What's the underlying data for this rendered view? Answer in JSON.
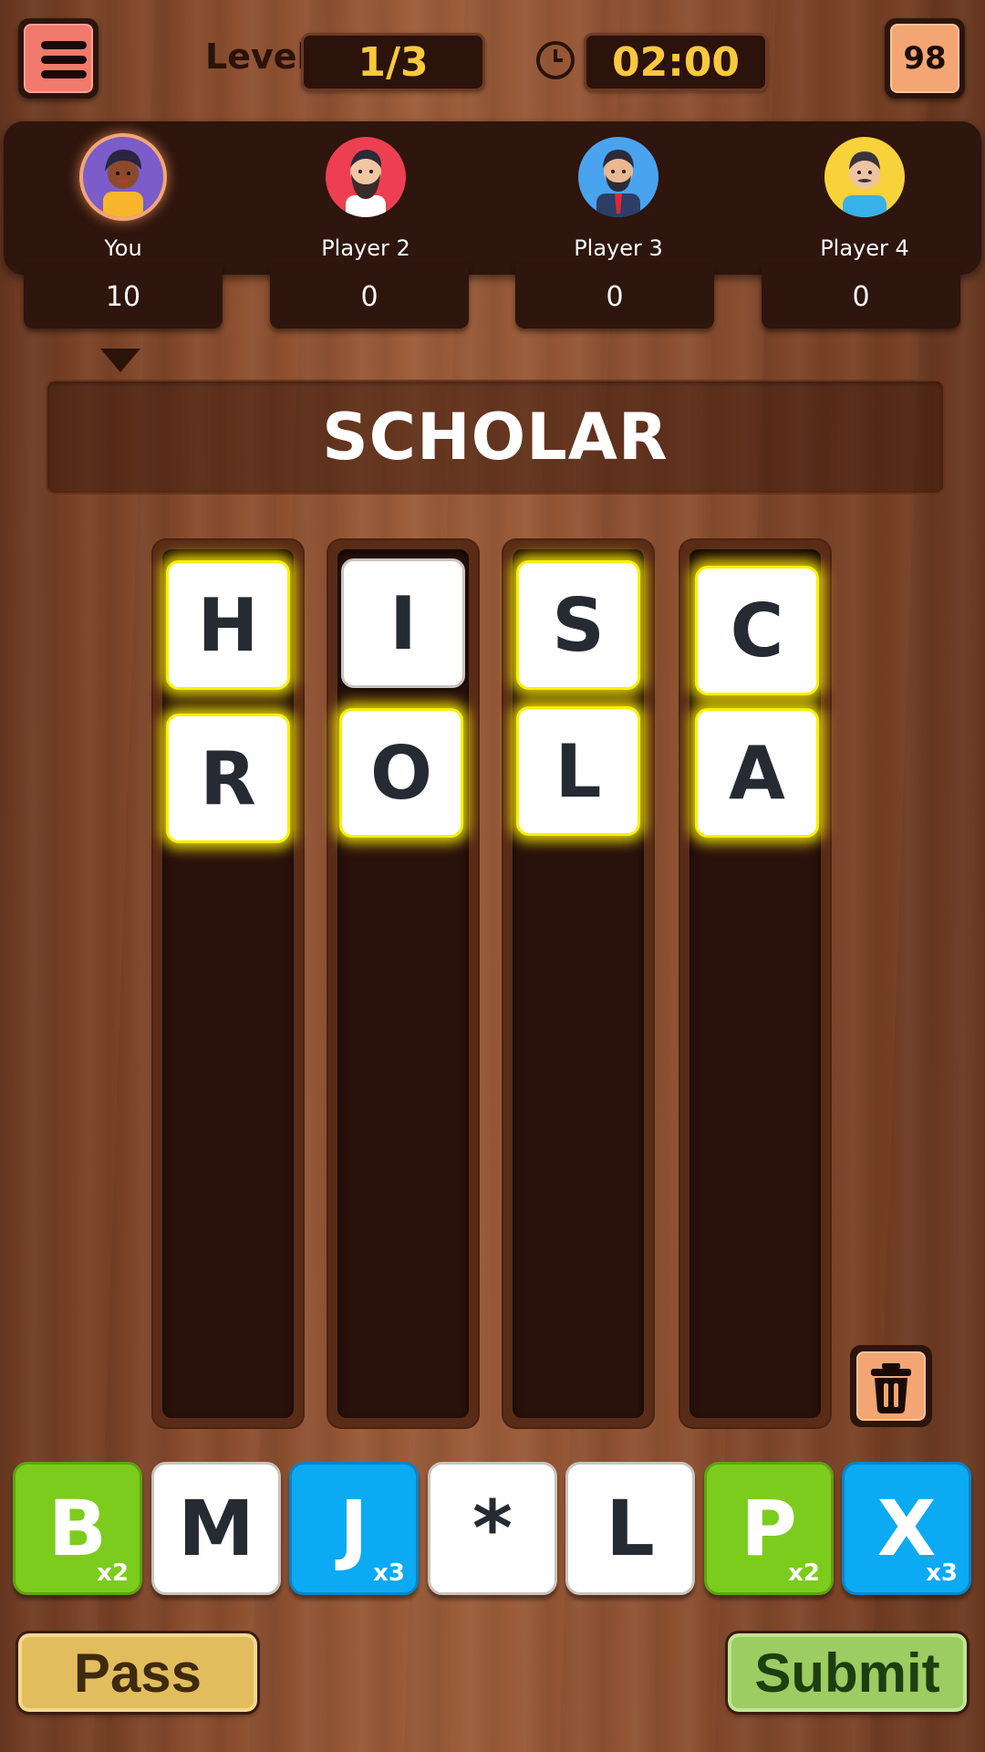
{
  "header": {
    "level_label": "Level",
    "level_value": "1/3",
    "timer": "02:00",
    "coins": "98",
    "icons": [
      "menu-icon",
      "clock-icon"
    ]
  },
  "players": [
    {
      "name": "You",
      "score": "10",
      "avatar_color": "#7b5cc9"
    },
    {
      "name": "Player 2",
      "score": "0",
      "avatar_color": "#ee3f52"
    },
    {
      "name": "Player 3",
      "score": "0",
      "avatar_color": "#4aa3ee"
    },
    {
      "name": "Player 4",
      "score": "0",
      "avatar_color": "#f8d23a"
    }
  ],
  "current_word": "SCHOLAR",
  "columns": [
    {
      "tiles": [
        {
          "letter": "H",
          "highlighted": true
        },
        {
          "letter": "R",
          "highlighted": true
        }
      ]
    },
    {
      "tiles": [
        {
          "letter": "I",
          "highlighted": false
        },
        {
          "letter": "O",
          "highlighted": true
        }
      ]
    },
    {
      "tiles": [
        {
          "letter": "S",
          "highlighted": true
        },
        {
          "letter": "L",
          "highlighted": true
        }
      ]
    },
    {
      "tiles": [
        {
          "letter": "C",
          "highlighted": true
        },
        {
          "letter": "A",
          "highlighted": true
        }
      ]
    }
  ],
  "rack": [
    {
      "letter": "B",
      "color": "green",
      "multiplier": "x2"
    },
    {
      "letter": "M",
      "color": "white",
      "multiplier": ""
    },
    {
      "letter": "J",
      "color": "blue",
      "multiplier": "x3"
    },
    {
      "letter": "*",
      "color": "white",
      "multiplier": ""
    },
    {
      "letter": "L",
      "color": "white",
      "multiplier": ""
    },
    {
      "letter": "P",
      "color": "green",
      "multiplier": "x2"
    },
    {
      "letter": "X",
      "color": "blue",
      "multiplier": "x3"
    }
  ],
  "buttons": {
    "pass": "Pass",
    "submit": "Submit"
  },
  "colors": {
    "glow": "#f7f000",
    "timer_text": "#f8c93c",
    "green_tile": "#7ccc1d",
    "blue_tile": "#0baaf3",
    "pass_button": "#e2bd5e",
    "submit_button": "#9ccc62"
  }
}
